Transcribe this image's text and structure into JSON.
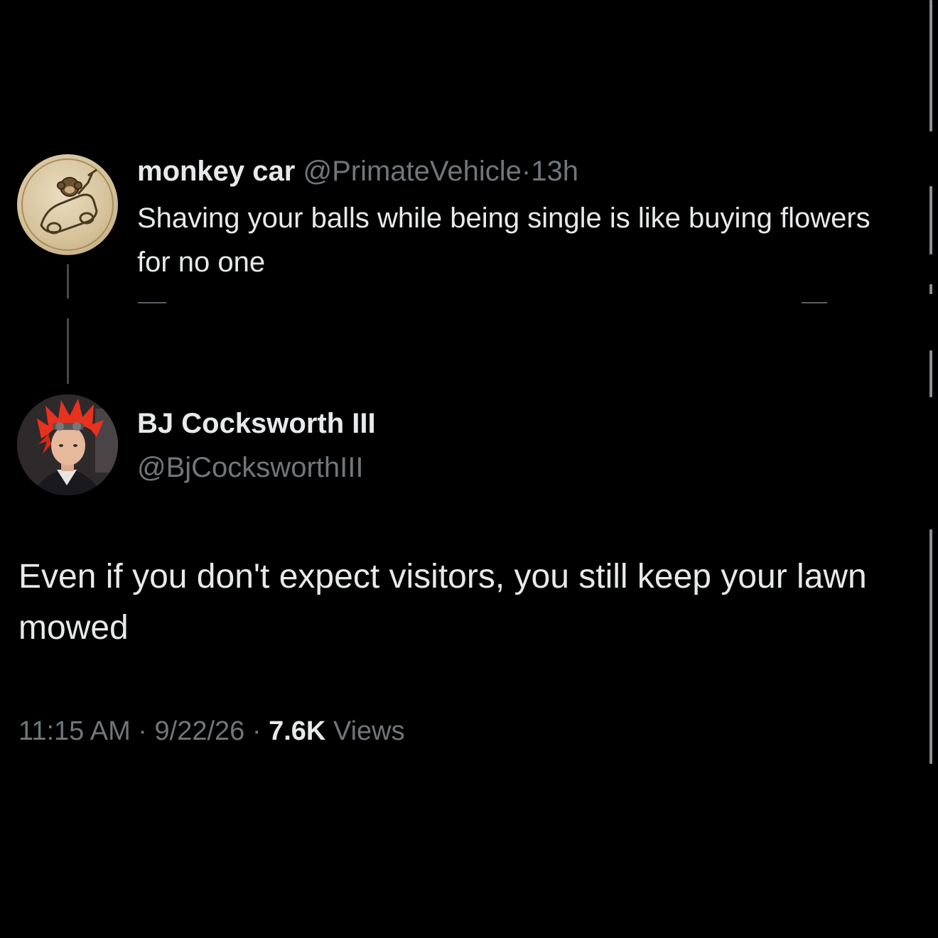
{
  "parent_tweet": {
    "display_name": "monkey car",
    "handle": "@PrimateVehicle",
    "separator": "·",
    "time_ago": "13h",
    "text": "Shaving your balls while being single is like buying flowers for no one",
    "avatar_icon": "monkey-driving-car-icon"
  },
  "reply_tweet": {
    "display_name": "BJ Cocksworth III",
    "handle": "@BjCocksworthIII",
    "text": "Even if you don't expect visitors, you still keep your lawn mowed",
    "avatar_icon": "red-haired-character-avatar",
    "time": "11:15 AM",
    "separator_1": "·",
    "date": "9/22/26",
    "separator_2": "·",
    "views_count": "7.6K",
    "views_label": "Views"
  },
  "colors": {
    "background": "#000000",
    "primary_text": "#e7e9ea",
    "secondary_text": "#71767b",
    "thread_line": "#45494d"
  }
}
